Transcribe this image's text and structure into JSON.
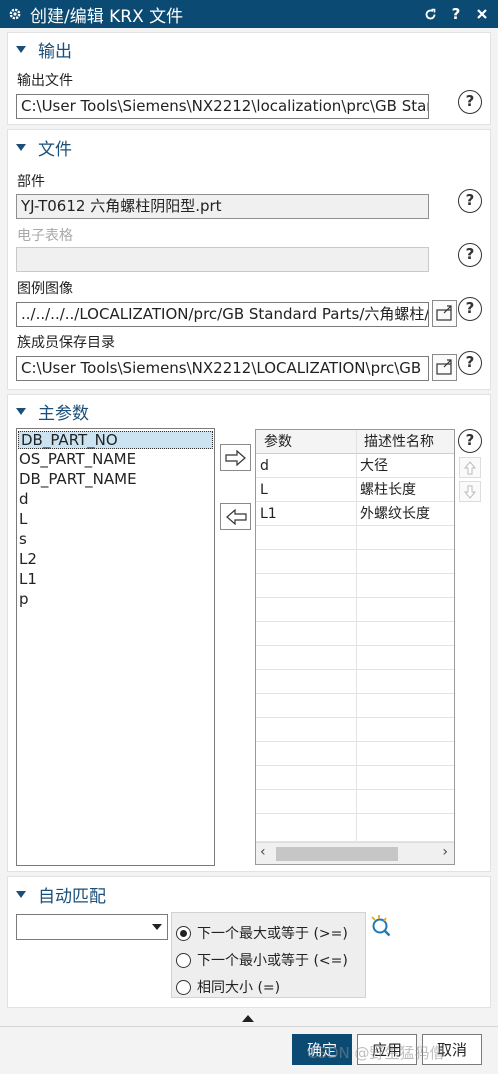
{
  "window": {
    "title": "创建/编辑 KRX 文件",
    "icons": [
      "gear-icon",
      "reset-icon",
      "help-icon",
      "close-icon"
    ]
  },
  "output": {
    "header": "输出",
    "file_label": "输出文件",
    "file_value": "C:\\User Tools\\Siemens\\NX2212\\localization\\prc\\GB Star"
  },
  "file": {
    "header": "文件",
    "part_label": "部件",
    "part_value": "YJ-T0612 六角螺柱阴阳型.prt",
    "spreadsheet_label": "电子表格",
    "spreadsheet_value": "",
    "image_label": "图例图像",
    "image_value": "../../../../LOCALIZATION/prc/GB Standard Parts/六角螺柱/",
    "dir_label": "族成员保存目录",
    "dir_value": "C:\\User Tools\\Siemens\\NX2212\\LOCALIZATION\\prc\\GB"
  },
  "main_params": {
    "header": "主参数",
    "available": [
      "DB_PART_NO",
      "OS_PART_NAME",
      "DB_PART_NAME",
      "d",
      "L",
      "s",
      "L2",
      "L1",
      "p"
    ],
    "selected_index": 0,
    "columns": [
      "参数",
      "描述性名称"
    ],
    "rows": [
      {
        "param": "d",
        "desc": "大径"
      },
      {
        "param": "L",
        "desc": "螺柱长度"
      },
      {
        "param": "L1",
        "desc": "外螺纹长度"
      }
    ]
  },
  "auto_match": {
    "header": "自动匹配",
    "dropdown_value": "",
    "options": [
      "下一个最大或等于 (>=)",
      "下一个最小或等于 (<=)",
      "相同大小 (=)"
    ],
    "selected_option": 0
  },
  "footer": {
    "ok": "确定",
    "apply": "应用",
    "cancel": "取消",
    "watermark": "CSDN @野生猛犸僧"
  },
  "colors": {
    "titlebar": "#0b4a72",
    "accent": "#1a4f7a",
    "selection": "#cce4f2",
    "ok_button": "#0b4a72"
  }
}
